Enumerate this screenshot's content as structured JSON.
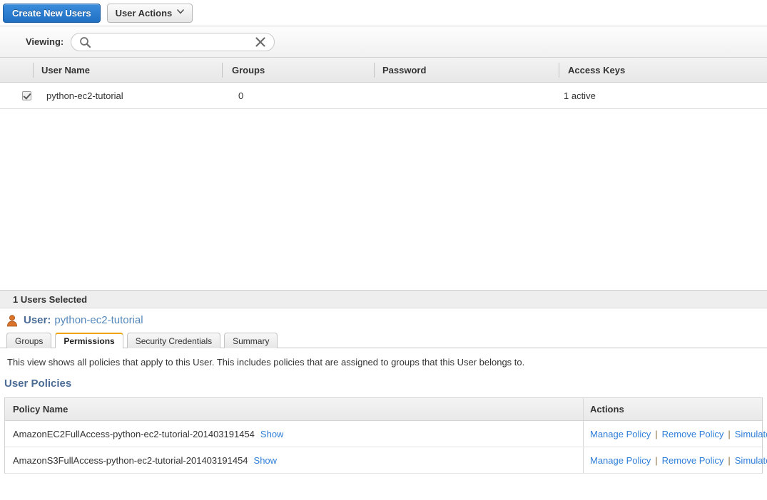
{
  "toolbar": {
    "create_users_label": "Create New Users",
    "user_actions_label": "User Actions",
    "caret_glyph": "⌄"
  },
  "viewing": {
    "label": "Viewing:",
    "search_value": "",
    "search_placeholder": "",
    "search_icon": "search-icon",
    "clear_icon": "clear-icon"
  },
  "users_table": {
    "columns": [
      "User Name",
      "Groups",
      "Password",
      "Access Keys"
    ],
    "rows": [
      {
        "selected": true,
        "user_name": "python-ec2-tutorial",
        "groups": "0",
        "password": "",
        "access_keys": "1 active"
      }
    ]
  },
  "selected_panel": {
    "selection_summary": "1 Users Selected",
    "user_icon": "user-icon",
    "user_keyword": "User:",
    "user_name": "python-ec2-tutorial",
    "tabs": [
      {
        "label": "Groups",
        "active": false
      },
      {
        "label": "Permissions",
        "active": true
      },
      {
        "label": "Security Credentials",
        "active": false
      },
      {
        "label": "Summary",
        "active": false
      }
    ],
    "permissions": {
      "description": "This view shows all policies that apply to this User. This includes policies that are assigned to groups that this User belongs to.",
      "section_title": "User Policies",
      "policy_table": {
        "columns": [
          "Policy Name",
          "Actions"
        ],
        "rows": [
          {
            "policy_name": "AmazonEC2FullAccess-python-ec2-tutorial-201403191454",
            "show_label": "Show",
            "actions": [
              "Manage Policy",
              "Remove Policy",
              "Simulate Policy"
            ]
          },
          {
            "policy_name": "AmazonS3FullAccess-python-ec2-tutorial-201403191454",
            "show_label": "Show",
            "actions": [
              "Manage Policy",
              "Remove Policy",
              "Simulate Policy"
            ]
          }
        ]
      }
    }
  },
  "colors": {
    "primary_button": "#1f6fc4",
    "link": "#2f7ed8",
    "active_tab_accent": "#f0a30a",
    "heading": "#4a6c97"
  }
}
